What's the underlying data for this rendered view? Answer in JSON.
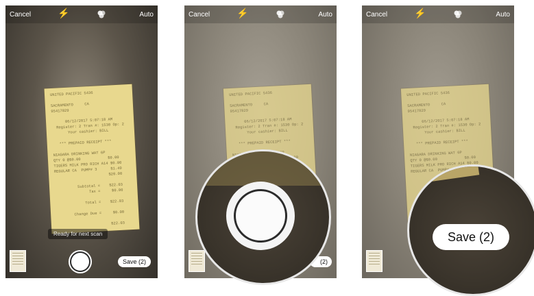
{
  "topbar": {
    "cancel": "Cancel",
    "auto": "Auto"
  },
  "receipt_lines": [
    "UNITED PACIFIC 5436",
    "",
    "SACRAMENTO     CA",
    "95417829",
    "",
    "      06/12/2017 5:07:18 AM",
    "  Register: 2 Tran #: 1530 Op: 2",
    "       Your cashier: BILL",
    "",
    "   *** PREPAID RECEIPT ***",
    "",
    "NIAGARA DRINKING WAT 6P",
    "QTY 0 @$0.00            $0.00",
    "TIGERS MILK PRO RICH A14 $0.00",
    "REGULAR CA  PUMP# 3      $1.49",
    "                        $20.00",
    "",
    "          Subtotal =    $22.03",
    "               Tax =     $0.00",
    "",
    "             Total =    $22.03",
    "",
    "        Change Due =     $0.00",
    "",
    "                        $22.03"
  ],
  "status": {
    "ready": "Ready for next scan"
  },
  "save_button": {
    "label": "Save (2)",
    "partial_label": "(2)"
  },
  "colors": {
    "receipt": "#e8d88e",
    "button_bg": "#ffffff"
  },
  "icons": [
    "flash-icon",
    "filter-icon",
    "scan-thumbnail-icon",
    "shutter-button"
  ]
}
